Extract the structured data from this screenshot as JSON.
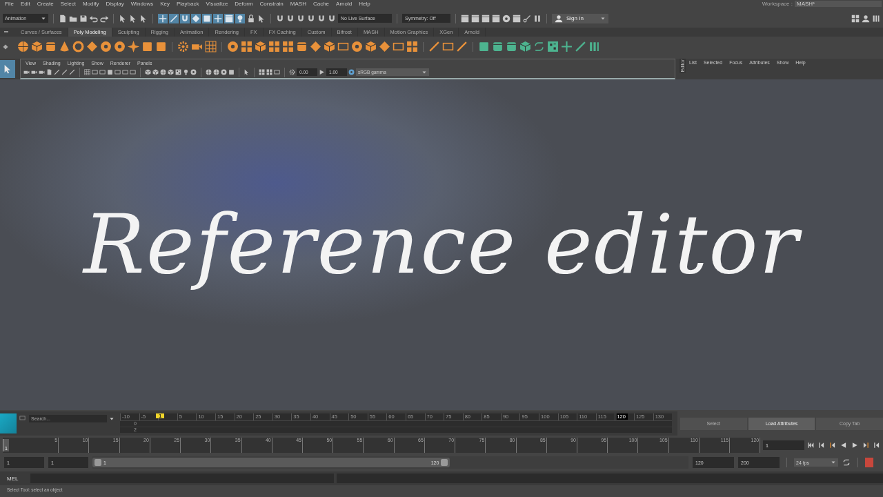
{
  "menu_bar": {
    "items": [
      "File",
      "Edit",
      "Create",
      "Select",
      "Modify",
      "Display",
      "Windows",
      "Key",
      "Playback",
      "Visualize",
      "Deform",
      "Constrain",
      "MASH",
      "Cache",
      "Arnold",
      "Help"
    ],
    "workspace_label": "Workspace :",
    "workspace_value": "MASH*"
  },
  "status_line": {
    "mode": "Animation",
    "live_surface": "No Live Surface",
    "symmetry": "Symmetry: Off",
    "sign_in": "Sign In"
  },
  "shelf": {
    "tabs": [
      {
        "label": "Curves / Surfaces",
        "selected": false
      },
      {
        "label": "Poly Modeling",
        "selected": true
      },
      {
        "label": "Sculpting",
        "selected": false
      },
      {
        "label": "Rigging",
        "selected": false
      },
      {
        "label": "Animation",
        "selected": false
      },
      {
        "label": "Rendering",
        "selected": false
      },
      {
        "label": "FX",
        "selected": false
      },
      {
        "label": "FX Caching",
        "selected": false
      },
      {
        "label": "Custom",
        "selected": false
      },
      {
        "label": "Bifrost",
        "selected": false
      },
      {
        "label": "MASH",
        "selected": false
      },
      {
        "label": "Motion Graphics",
        "selected": false
      },
      {
        "label": "XGen",
        "selected": false
      },
      {
        "label": "Arnold",
        "selected": false
      }
    ]
  },
  "panel": {
    "menus": [
      "View",
      "Shading",
      "Lighting",
      "Show",
      "Renderer",
      "Panels"
    ],
    "exposure": "0.00",
    "gamma": "1.00",
    "color_space": "sRGB gamma"
  },
  "editor": {
    "title": "Editor",
    "menus": [
      "List",
      "Selected",
      "Focus",
      "Attributes",
      "Show",
      "Help"
    ]
  },
  "viewport": {
    "overlay_title": "Reference editor"
  },
  "search": {
    "placeholder": "Search..."
  },
  "graph_timeline": {
    "ticks": [
      {
        "label": "-10",
        "kind": "tick"
      },
      {
        "label": "-5",
        "kind": "tick"
      },
      {
        "label": "1",
        "kind": "current"
      },
      {
        "label": "5",
        "kind": "tick"
      },
      {
        "label": "10",
        "kind": "tick"
      },
      {
        "label": "15",
        "kind": "tick"
      },
      {
        "label": "20",
        "kind": "tick"
      },
      {
        "label": "25",
        "kind": "tick"
      },
      {
        "label": "30",
        "kind": "tick"
      },
      {
        "label": "35",
        "kind": "tick"
      },
      {
        "label": "40",
        "kind": "tick"
      },
      {
        "label": "45",
        "kind": "tick"
      },
      {
        "label": "50",
        "kind": "tick"
      },
      {
        "label": "55",
        "kind": "tick"
      },
      {
        "label": "60",
        "kind": "tick"
      },
      {
        "label": "65",
        "kind": "tick"
      },
      {
        "label": "70",
        "kind": "tick"
      },
      {
        "label": "75",
        "kind": "tick"
      },
      {
        "label": "80",
        "kind": "tick"
      },
      {
        "label": "85",
        "kind": "tick"
      },
      {
        "label": "90",
        "kind": "tick"
      },
      {
        "label": "95",
        "kind": "tick"
      },
      {
        "label": "100",
        "kind": "tick"
      },
      {
        "label": "105",
        "kind": "tick"
      },
      {
        "label": "110",
        "kind": "tick"
      },
      {
        "label": "115",
        "kind": "tick"
      },
      {
        "label": "120",
        "kind": "end"
      },
      {
        "label": "125",
        "kind": "tick"
      },
      {
        "label": "130",
        "kind": "tick"
      }
    ],
    "row_labels": [
      "0",
      "2"
    ]
  },
  "attribute_buttons": [
    {
      "label": "Select",
      "selected": false
    },
    {
      "label": "Load Attributes",
      "selected": true
    },
    {
      "label": "Copy Tab",
      "selected": false
    }
  ],
  "time_slider": {
    "ticks": [
      {
        "label": "1",
        "kind": "current"
      },
      {
        "label": "5",
        "kind": "tick"
      },
      {
        "label": "10",
        "kind": "tick"
      },
      {
        "label": "15",
        "kind": "tick"
      },
      {
        "label": "20",
        "kind": "tick"
      },
      {
        "label": "25",
        "kind": "tick"
      },
      {
        "label": "30",
        "kind": "tick"
      },
      {
        "label": "35",
        "kind": "tick"
      },
      {
        "label": "40",
        "kind": "tick"
      },
      {
        "label": "45",
        "kind": "tick"
      },
      {
        "label": "50",
        "kind": "tick"
      },
      {
        "label": "55",
        "kind": "tick"
      },
      {
        "label": "60",
        "kind": "tick"
      },
      {
        "label": "65",
        "kind": "tick"
      },
      {
        "label": "70",
        "kind": "tick"
      },
      {
        "label": "75",
        "kind": "tick"
      },
      {
        "label": "80",
        "kind": "tick"
      },
      {
        "label": "85",
        "kind": "tick"
      },
      {
        "label": "90",
        "kind": "tick"
      },
      {
        "label": "95",
        "kind": "tick"
      },
      {
        "label": "100",
        "kind": "tick"
      },
      {
        "label": "105",
        "kind": "tick"
      },
      {
        "label": "110",
        "kind": "tick"
      },
      {
        "label": "115",
        "kind": "tick"
      },
      {
        "label": "120",
        "kind": "tick"
      }
    ],
    "level": 0,
    "current_frame": "1"
  },
  "range_slider": {
    "level": 0.6,
    "start": "1",
    "playback_start": "1",
    "handle_start": "1",
    "handle_end": "120",
    "playback_end": "120",
    "end": "200",
    "fps": "24 fps"
  },
  "command_line": {
    "label": "MEL"
  },
  "help_line": "Select Tool: select an object"
}
